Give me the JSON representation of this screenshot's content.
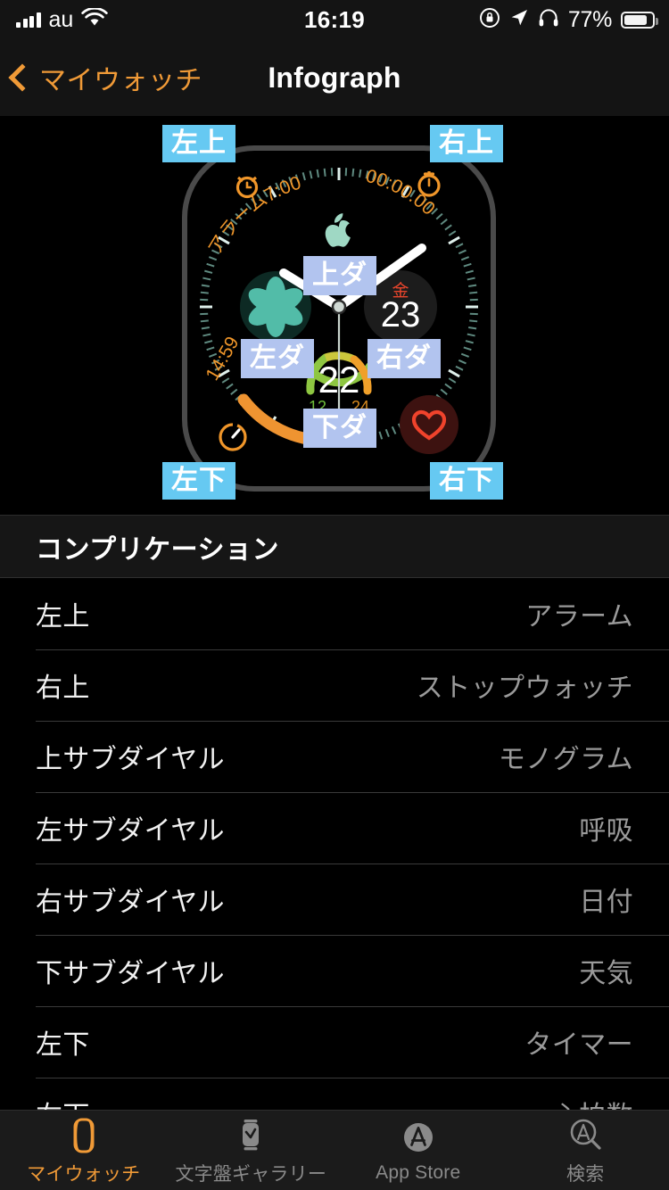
{
  "status_bar": {
    "carrier": "au",
    "time": "16:19",
    "battery_percent": "77%",
    "icons": [
      "signal-bars-icon",
      "wifi-icon",
      "rotation-lock-icon",
      "location-arrow-icon",
      "headphones-icon",
      "battery-icon"
    ]
  },
  "nav": {
    "back_label": "マイウォッチ",
    "title": "Infograph"
  },
  "watch_preview": {
    "badges": [
      {
        "key": "top_left",
        "label": "左上",
        "style": "cyan"
      },
      {
        "key": "top_right",
        "label": "右上",
        "style": "cyan"
      },
      {
        "key": "top_subdial",
        "label": "上ダ",
        "style": "lavender"
      },
      {
        "key": "left_subdial",
        "label": "左ダ",
        "style": "lavender"
      },
      {
        "key": "right_subdial",
        "label": "右ダ",
        "style": "lavender"
      },
      {
        "key": "bottom_subdial",
        "label": "下ダ",
        "style": "lavender"
      },
      {
        "key": "bottom_left",
        "label": "左下",
        "style": "cyan"
      },
      {
        "key": "bottom_right",
        "label": "右下",
        "style": "cyan"
      }
    ],
    "complications": {
      "alarm_text": "アラーム7:00",
      "stopwatch_text": "00:00.00",
      "date_weekday": "金",
      "date_day": "23",
      "weather_temp": "22",
      "weather_low": "12",
      "weather_high": "24",
      "timer_text": "14:59"
    },
    "colors": {
      "accent_orange": "#f0962a",
      "badge_cyan": "#66c9f2",
      "badge_lavender": "#b2c4ef",
      "weekday_red": "#e8452c",
      "breathe_teal": "#5fd6c0",
      "heart_red": "#f0432c",
      "gauge_green": "#8ec641",
      "gauge_orange": "#f0a02a"
    }
  },
  "section": {
    "header": "コンプリケーション"
  },
  "rows": [
    {
      "label": "左上",
      "value": "アラーム"
    },
    {
      "label": "右上",
      "value": "ストップウォッチ"
    },
    {
      "label": "上サブダイヤル",
      "value": "モノグラム"
    },
    {
      "label": "左サブダイヤル",
      "value": "呼吸"
    },
    {
      "label": "右サブダイヤル",
      "value": "日付"
    },
    {
      "label": "下サブダイヤル",
      "value": "天気"
    },
    {
      "label": "左下",
      "value": "タイマー"
    },
    {
      "label": "右下",
      "value": "心拍数"
    }
  ],
  "tabs": [
    {
      "label": "マイウォッチ",
      "icon": "watch-icon",
      "active": true
    },
    {
      "label": "文字盤ギャラリー",
      "icon": "watch-face-icon",
      "active": false
    },
    {
      "label": "App Store",
      "icon": "app-store-icon",
      "active": false
    },
    {
      "label": "検索",
      "icon": "search-icon",
      "active": false
    }
  ]
}
